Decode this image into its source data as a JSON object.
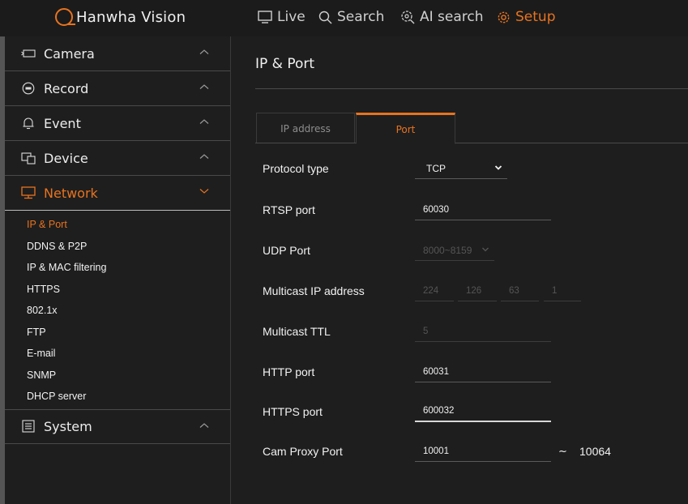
{
  "brand": {
    "name": "Hanwha Vision"
  },
  "top_nav": [
    {
      "label": "Live",
      "icon": "monitor-icon",
      "active": false
    },
    {
      "label": "Search",
      "icon": "search-icon",
      "active": false
    },
    {
      "label": "AI search",
      "icon": "ai-search-icon",
      "active": false
    },
    {
      "label": "Setup",
      "icon": "gear-icon",
      "active": true
    }
  ],
  "sidebar": {
    "sections": [
      {
        "label": "Camera",
        "icon": "camera-icon"
      },
      {
        "label": "Record",
        "icon": "record-icon"
      },
      {
        "label": "Event",
        "icon": "bell-icon"
      },
      {
        "label": "Device",
        "icon": "device-icon"
      },
      {
        "label": "Network",
        "icon": "network-icon",
        "active": true
      },
      {
        "label": "System",
        "icon": "system-icon"
      }
    ],
    "network_items": [
      {
        "label": "IP & Port",
        "active": true
      },
      {
        "label": "DDNS & P2P"
      },
      {
        "label": "IP & MAC filtering"
      },
      {
        "label": "HTTPS"
      },
      {
        "label": "802.1x"
      },
      {
        "label": "FTP"
      },
      {
        "label": "E-mail"
      },
      {
        "label": "SNMP"
      },
      {
        "label": "DHCP server"
      }
    ]
  },
  "main": {
    "title": "IP & Port",
    "tabs": [
      {
        "label": "IP address",
        "active": false
      },
      {
        "label": "Port",
        "active": true
      }
    ],
    "protocol_type": {
      "label": "Protocol type",
      "value": "TCP"
    },
    "rtsp_port": {
      "label": "RTSP port",
      "value": "60030"
    },
    "udp_port": {
      "label": "UDP Port",
      "value": "8000~8159"
    },
    "multicast_ip": {
      "label": "Multicast IP address",
      "octets": [
        "224",
        "126",
        "63",
        "1"
      ]
    },
    "multicast_ttl": {
      "label": "Multicast TTL",
      "value": "5"
    },
    "http_port": {
      "label": "HTTP port",
      "value": "60031"
    },
    "https_port": {
      "label": "HTTPS port",
      "value": "600032"
    },
    "cam_proxy_port": {
      "label": "Cam Proxy Port",
      "value": "10001",
      "separator": "~",
      "range_end": "10064"
    }
  },
  "colors": {
    "accent": "#e8731f",
    "background": "#1e1e1e",
    "text": "#f2f2f2",
    "disabled": "#555555"
  }
}
